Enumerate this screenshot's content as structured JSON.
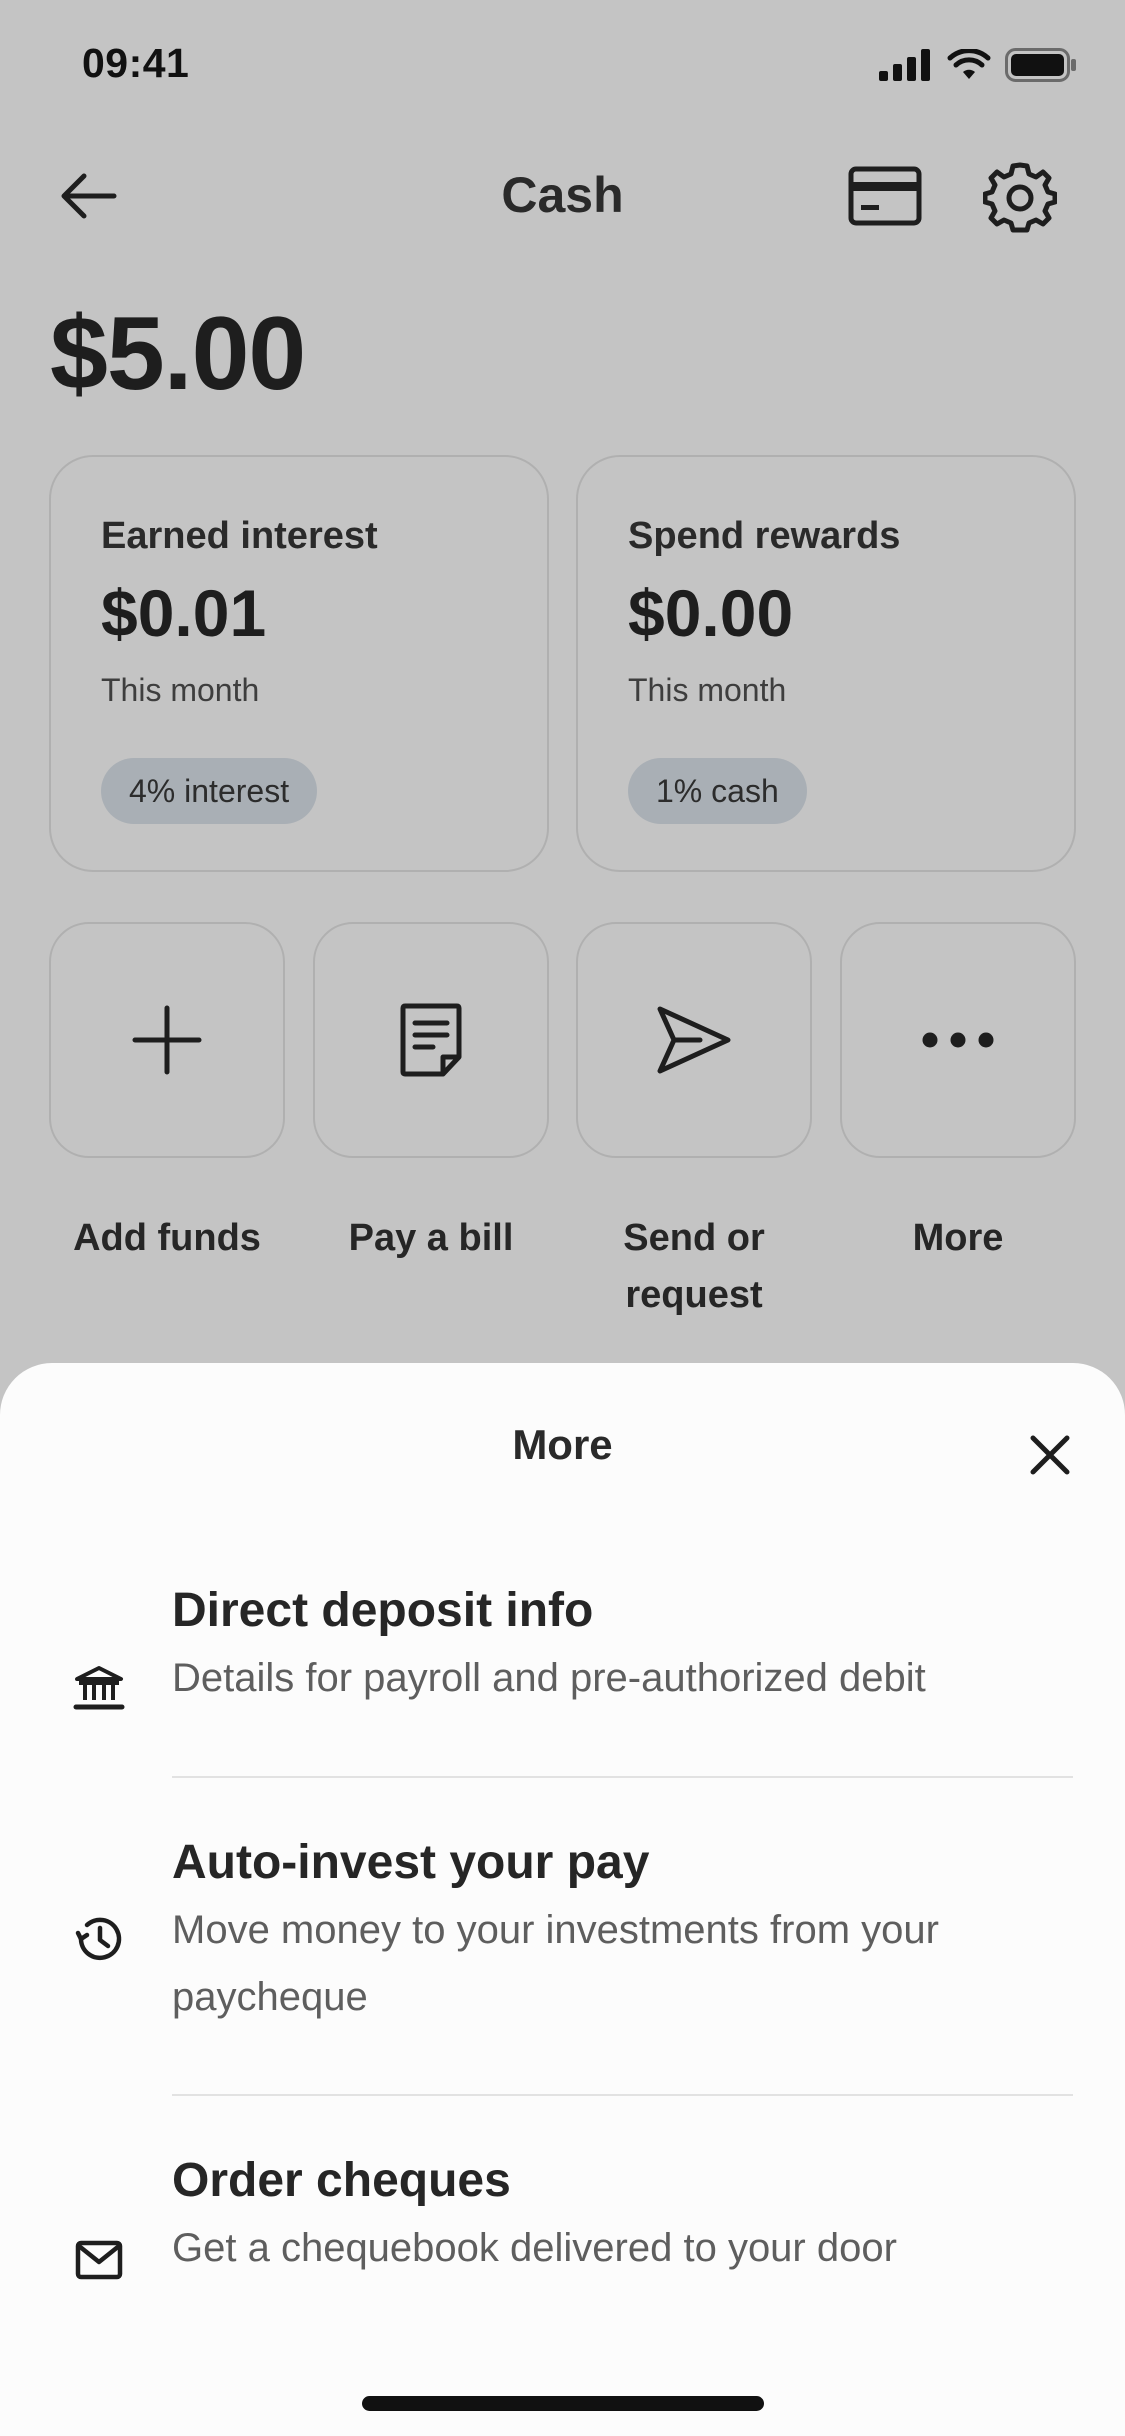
{
  "status_bar": {
    "time": "09:41"
  },
  "nav": {
    "title": "Cash"
  },
  "balance": "$5.00",
  "cards": [
    {
      "label": "Earned interest",
      "value": "$0.01",
      "period": "This month",
      "pill": "4% interest"
    },
    {
      "label": "Spend rewards",
      "value": "$0.00",
      "period": "This month",
      "pill": "1% cash"
    }
  ],
  "actions": [
    {
      "label": "Add funds",
      "icon": "plus-icon"
    },
    {
      "label": "Pay a bill",
      "icon": "document-icon"
    },
    {
      "label": "Send or request",
      "icon": "send-icon"
    },
    {
      "label": "More",
      "icon": "more-dots-icon"
    }
  ],
  "sheet": {
    "title": "More",
    "items": [
      {
        "title": "Direct deposit info",
        "description": "Details for payroll and pre-authorized debit",
        "icon": "bank-icon"
      },
      {
        "title": "Auto-invest your pay",
        "description": "Move money to your investments from your paycheque",
        "icon": "history-icon"
      },
      {
        "title": "Order cheques",
        "description": "Get a chequebook delivered to your door",
        "icon": "envelope-icon"
      }
    ]
  },
  "colors": {
    "background_dimmed": "#c4c4c4",
    "sheet_background": "#fcfcfc",
    "pill_background": "#a9afb5",
    "text_primary": "#262626",
    "text_secondary": "#5e5e5e"
  }
}
